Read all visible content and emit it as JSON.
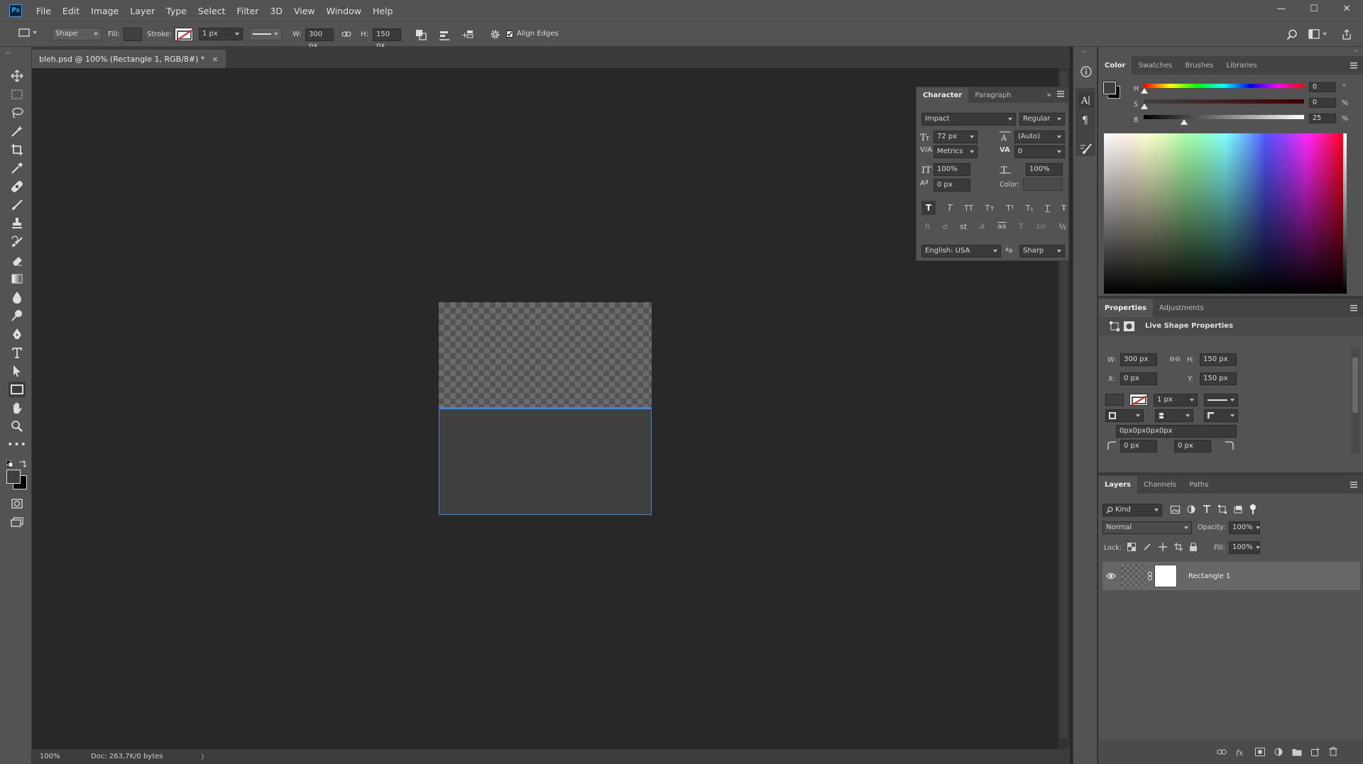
{
  "app": {
    "logo": "Ps"
  },
  "menu": [
    "File",
    "Edit",
    "Image",
    "Layer",
    "Type",
    "Select",
    "Filter",
    "3D",
    "View",
    "Window",
    "Help"
  ],
  "window_controls": {
    "minimize": "—",
    "maximize": "☐",
    "close": "✕"
  },
  "options": {
    "tool_mode": "Shape",
    "fill_label": "Fill:",
    "stroke_label": "Stroke:",
    "stroke_width": "1 px",
    "w_label": "W:",
    "w_value": "300 px",
    "h_label": "H:",
    "h_value": "150 px",
    "align_edges_label": "Align Edges",
    "align_edges_checked": true
  },
  "document": {
    "tab_title": "bleh.psd @ 100% (Rectangle 1, RGB/8#) *",
    "tab_close": "×",
    "zoom": "100%",
    "doc_info": "Doc: 263,7K/0 bytes",
    "status_arrow": "〉"
  },
  "character_panel": {
    "tabs": [
      "Character",
      "Paragraph"
    ],
    "font_family": "Impact",
    "font_style": "Regular",
    "font_size": "72 px",
    "leading": "(Auto)",
    "kerning": "Metrics",
    "tracking": "0",
    "vertical_scale": "100%",
    "horizontal_scale": "100%",
    "baseline_shift": "0 px",
    "color_label": "Color:",
    "style_buttons": [
      "T",
      "T",
      "TT",
      "Tт",
      "T¹",
      "T₁",
      "T",
      "Ŧ"
    ],
    "opentype_buttons": [
      "fi",
      "ơ",
      "st",
      "A",
      "aa",
      "T",
      "1st",
      "½"
    ],
    "language": "English: USA",
    "aa_icon": "ªa",
    "antialias": "Sharp",
    "collapse": "»"
  },
  "color_panel": {
    "tabs": [
      "Color",
      "Swatches",
      "Brushes",
      "Libraries"
    ],
    "channels": [
      {
        "label": "H",
        "value": "0",
        "unit": "°",
        "pos": 0.0
      },
      {
        "label": "S",
        "value": "0",
        "unit": "%",
        "pos": 0.0
      },
      {
        "label": "B",
        "value": "25",
        "unit": "%",
        "pos": 0.25
      }
    ],
    "foreground": "#404040",
    "background": "#000000"
  },
  "properties_panel": {
    "tabs": [
      "Properties",
      "Adjustments"
    ],
    "title": "Live Shape Properties",
    "w_label": "W:",
    "w_value": "300 px",
    "link_icon": "⊖⊖",
    "h_label": "H:",
    "h_value": "150 px",
    "x_label": "X:",
    "x_value": "0 px",
    "y_label": "Y:",
    "y_value": "150 px",
    "stroke_width": "1 px",
    "corner_string": "0px0px0px0px",
    "corner_tl": "0 px",
    "corner_tr": "0 px"
  },
  "layers_panel": {
    "tabs": [
      "Layers",
      "Channels",
      "Paths"
    ],
    "filter_label": "Kind",
    "blend_mode": "Normal",
    "opacity_label": "Opacity:",
    "opacity_value": "100%",
    "lock_label": "Lock:",
    "fill_label": "Fill:",
    "fill_value": "100%",
    "layers": [
      {
        "name": "Rectangle 1",
        "visible": true,
        "selected": true
      }
    ]
  },
  "colors": {
    "accent": "#3c85d8",
    "chrome": "#535353",
    "canvas_bg": "#282828"
  }
}
